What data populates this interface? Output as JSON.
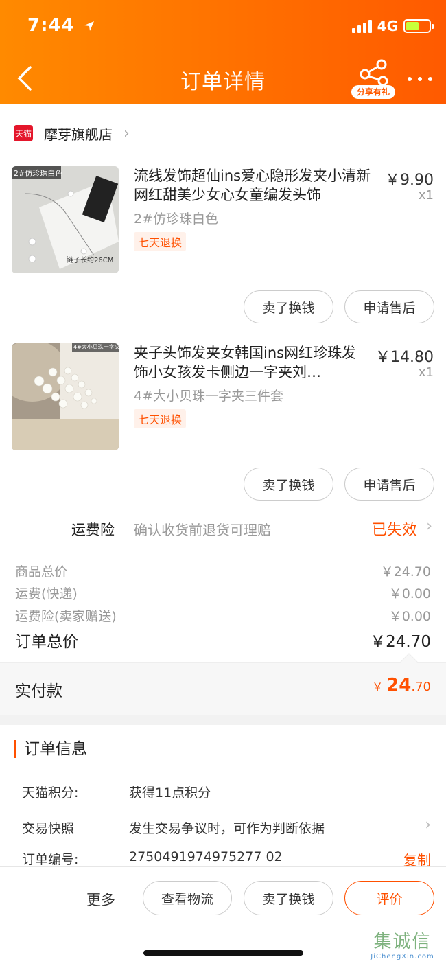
{
  "status_bar": {
    "time": "7:44",
    "network": "4G"
  },
  "header": {
    "title": "订单详情",
    "share_label": "分享有礼"
  },
  "shop": {
    "badge": "天猫",
    "name": "摩芽旗舰店"
  },
  "products": [
    {
      "title": "流线发饰超仙ins爱心隐形发夹小清新 网红甜美少女心女童编发头饰",
      "price": "￥9.90",
      "qty": "x1",
      "sku": "2#仿珍珠白色",
      "badge": "七天退换",
      "thumb_tag": "2#仿珍珠白色",
      "thumb_caption": "链子长约26CM",
      "btn_sell": "卖了换钱",
      "btn_after_sale": "申请售后"
    },
    {
      "title": "夹子头饰发夹女韩国ins网红珍珠发饰小女孩发卡侧边一字夹刘…",
      "price": "￥14.80",
      "qty": "x1",
      "sku": "4#大小贝珠一字夹三件套",
      "badge": "七天退换",
      "thumb_tag": "4#大小贝珠一字夹三件套",
      "btn_sell": "卖了换钱",
      "btn_after_sale": "申请售后"
    }
  ],
  "freight_insurance": {
    "label": "运费险",
    "desc": "确认收货前退货可理赔",
    "status": "已失效"
  },
  "summary": {
    "goods_total_label": "商品总价",
    "goods_total": "￥24.70",
    "shipping_label": "运费(快递)",
    "shipping": "￥0.00",
    "insurance_label": "运费险(卖家赠送)",
    "insurance": "￥0.00",
    "order_total_label": "订单总价",
    "order_total": "￥24.70"
  },
  "paid": {
    "label": "实付款",
    "currency": "￥",
    "integer": "24",
    "decimal": ".70"
  },
  "order_info": {
    "title": "订单信息",
    "points_label": "天猫积分:",
    "points_value": "获得11点积分",
    "snapshot_label": "交易快照",
    "snapshot_value": "发生交易争议时，可作为判断依据",
    "order_no_label": "订单编号:",
    "order_no_value": "2750491974975277 02",
    "copy_label": "复制"
  },
  "bottom_bar": {
    "more": "更多",
    "logistics": "查看物流",
    "sell": "卖了换钱",
    "review": "评价"
  },
  "watermark": {
    "main": "集诚信",
    "sub": "JiChengXin.com"
  },
  "colors": {
    "accent": "#ff5000",
    "header_start": "#ff8a00",
    "header_end": "#ff5a00"
  }
}
